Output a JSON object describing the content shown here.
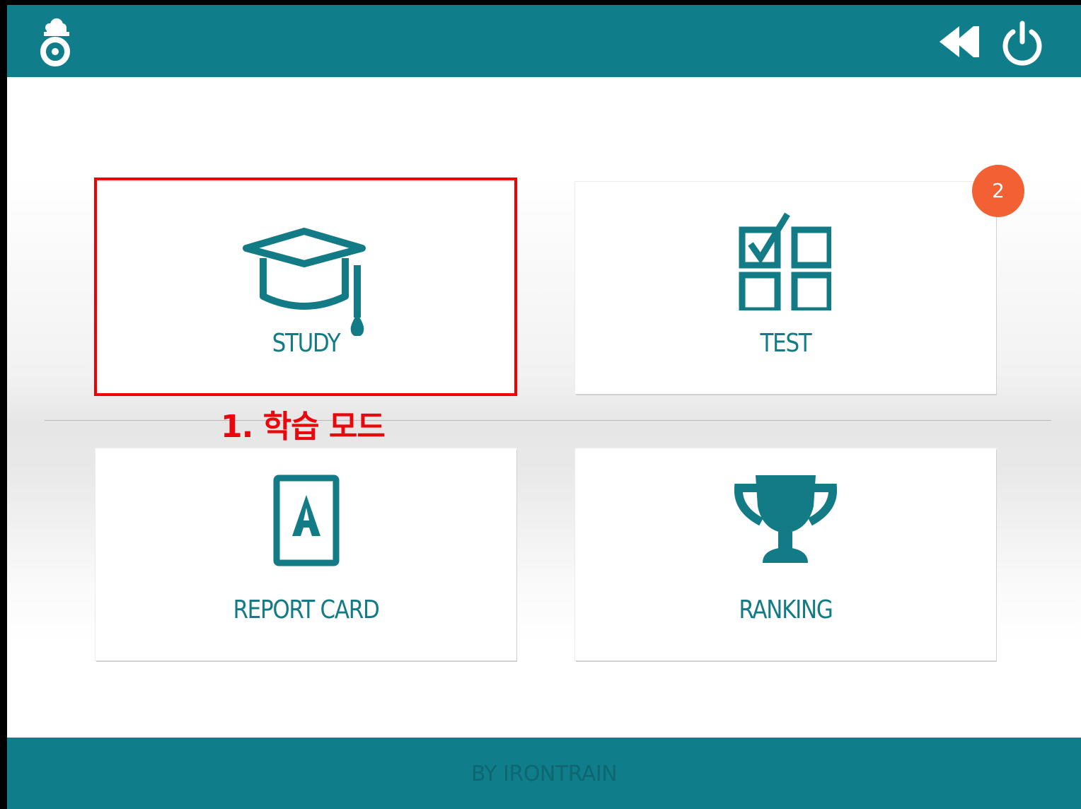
{
  "header": {
    "logo_icon": "logo-icon",
    "back_icon": "rewind-icon",
    "power_icon": "power-icon",
    "bar_color": "#0f7e8a"
  },
  "menu": {
    "tiles": [
      {
        "label": "STUDY",
        "icon": "graduation-cap-icon"
      },
      {
        "label": "TEST",
        "icon": "checklist-grid-icon",
        "badge": "2"
      },
      {
        "label": "REPORT CARD",
        "icon": "report-card-icon"
      },
      {
        "label": "RANKING",
        "icon": "trophy-icon"
      }
    ],
    "accent_color": "#137b86",
    "badge_color": "#f26134"
  },
  "annotation": {
    "text": "1. 학습 모드",
    "color": "#e8070d"
  },
  "footer": {
    "text": "BY IRONTRAIN"
  }
}
